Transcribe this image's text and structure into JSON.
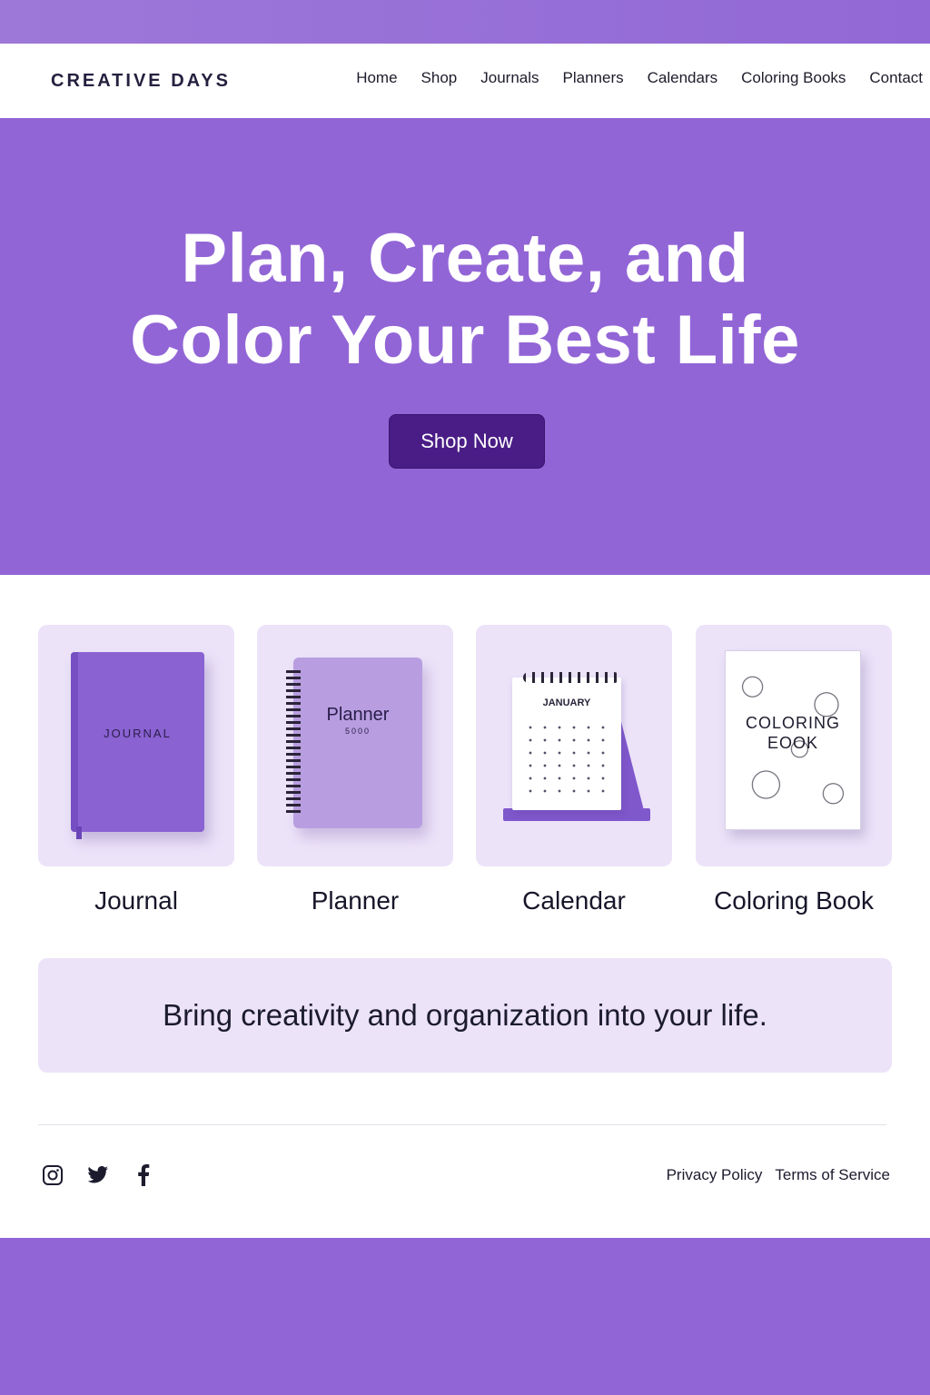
{
  "brand": {
    "name": "CREATIVE DAYS"
  },
  "nav": {
    "items": [
      "Home",
      "Shop",
      "Journals",
      "Planners",
      "Calendars",
      "Coloring Books",
      "Contact"
    ]
  },
  "hero": {
    "title_line1": "Plan, Create, and",
    "title_line2": "Color Your Best Life",
    "cta": "Shop Now"
  },
  "products": [
    {
      "label": "Journal",
      "cover_text": "JOURNAL"
    },
    {
      "label": "Planner",
      "cover_text": "Planner",
      "cover_sub": "5000"
    },
    {
      "label": "Calendar",
      "cover_text": "JANUARY"
    },
    {
      "label": "Coloring Book",
      "cover_text_line1": "COLORING",
      "cover_text_line2": "EOOK"
    }
  ],
  "tagline": "Bring creativity and organization into your life.",
  "footer": {
    "social_icons": [
      "instagram-icon",
      "twitter-icon",
      "facebook-icon"
    ],
    "links": [
      "Privacy Policy",
      "Terms of Service"
    ]
  },
  "colors": {
    "primary": "#9265d6",
    "dark_button": "#4a1d86",
    "card_bg": "#ece3f9",
    "text": "#1c1b2e"
  }
}
